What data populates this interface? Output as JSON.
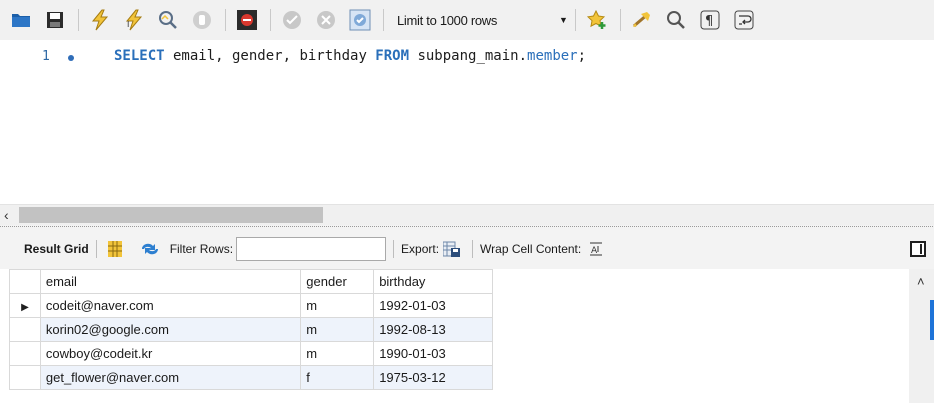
{
  "toolbar": {
    "icons": [
      "folder-icon",
      "save-icon",
      "execute-icon",
      "execute-current-icon",
      "explain-icon",
      "stop-icon",
      "toggle-error-stop-icon",
      "commit-icon",
      "rollback-icon",
      "autocommit-icon",
      "add-snippet-icon",
      "beautify-icon",
      "find-icon",
      "invisible-chars-icon",
      "word-wrap-icon"
    ],
    "limit_label": "Limit to 1000 rows"
  },
  "editor": {
    "line_number": "1",
    "tokens": {
      "kw_select": "SELECT",
      "columns": " email, gender, birthday ",
      "kw_from": "FROM",
      "schema": " subpang_main.",
      "table": "member",
      "terminator": ";"
    }
  },
  "result_toolbar": {
    "result_grid_label": "Result Grid",
    "filter_rows_label": "Filter Rows:",
    "filter_value": "",
    "export_label": "Export:",
    "wrap_label": "Wrap Cell Content:"
  },
  "grid": {
    "columns": [
      "email",
      "gender",
      "birthday"
    ],
    "rows": [
      [
        "codeit@naver.com",
        "m",
        "1992-01-03"
      ],
      [
        "korin02@google.com",
        "m",
        "1992-08-13"
      ],
      [
        "cowboy@codeit.kr",
        "m",
        "1990-01-03"
      ],
      [
        "get_flower@naver.com",
        "f",
        "1975-03-12"
      ]
    ]
  },
  "colors": {
    "keyword": "#2a6fba",
    "alt_row": "#eef3fb",
    "toolbar_bg": "#f1f1f1"
  }
}
